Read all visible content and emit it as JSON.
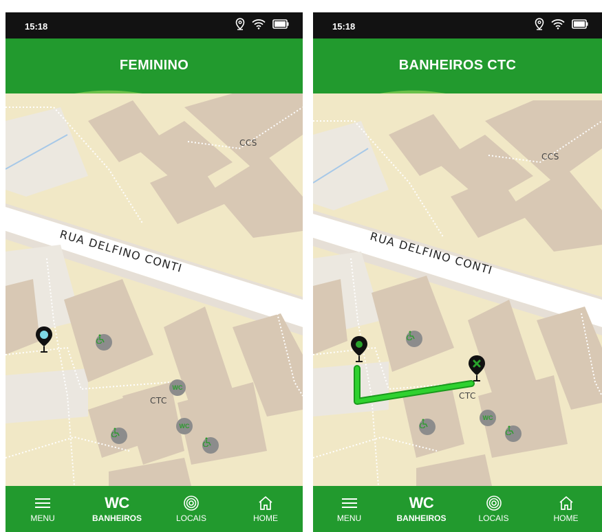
{
  "screens": [
    {
      "status": {
        "time": "15:18"
      },
      "header": {
        "title": "FEMININO"
      },
      "map": {
        "street": "RUA DELFINO CONTI",
        "place1": "CCS",
        "place2": "CTC"
      },
      "nav": [
        {
          "label": "MENU",
          "icon": "menu-icon"
        },
        {
          "label": "BANHEIROS",
          "icon_text": "WC",
          "icon": "wc-icon",
          "active": true
        },
        {
          "label": "LOCAIS",
          "icon": "target-icon"
        },
        {
          "label": "HOME",
          "icon": "home-icon"
        }
      ]
    },
    {
      "status": {
        "time": "15:18"
      },
      "header": {
        "title": "BANHEIROS CTC"
      },
      "map": {
        "street": "RUA DELFINO CONTI",
        "place1": "CCS",
        "place2": "CTC"
      },
      "nav": [
        {
          "label": "MENU",
          "icon": "menu-icon"
        },
        {
          "label": "BANHEIROS",
          "icon_text": "WC",
          "icon": "wc-icon",
          "active": true
        },
        {
          "label": "LOCAIS",
          "icon": "target-icon"
        },
        {
          "label": "HOME",
          "icon": "home-icon"
        }
      ]
    }
  ],
  "poi": {
    "wc": "WC"
  },
  "colors": {
    "primary_green": "#229a2e",
    "light_green": "#6cc04a",
    "route_green": "#1fc020",
    "building": "#d9c9b5",
    "land": "#f0e6c4"
  }
}
